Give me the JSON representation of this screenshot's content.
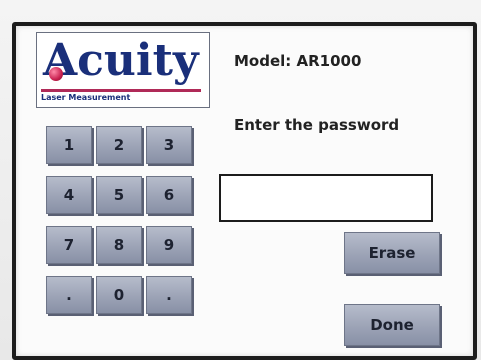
{
  "logo": {
    "brand": "Acuity",
    "tagline": "Laser Measurement"
  },
  "header": {
    "model_label": "Model: AR1000",
    "prompt": "Enter the password"
  },
  "keypad": {
    "keys": [
      {
        "label": "1"
      },
      {
        "label": "2"
      },
      {
        "label": "3"
      },
      {
        "label": "4"
      },
      {
        "label": "5"
      },
      {
        "label": "6"
      },
      {
        "label": "7"
      },
      {
        "label": "8"
      },
      {
        "label": "9"
      },
      {
        "label": "."
      },
      {
        "label": "0"
      },
      {
        "label": "."
      }
    ]
  },
  "password": {
    "value": "",
    "placeholder": ""
  },
  "actions": {
    "erase_label": "Erase",
    "done_label": "Done"
  },
  "colors": {
    "brand_blue": "#1a2f7a",
    "brand_magenta": "#b02a58",
    "button_face": "#9ca3b6"
  }
}
